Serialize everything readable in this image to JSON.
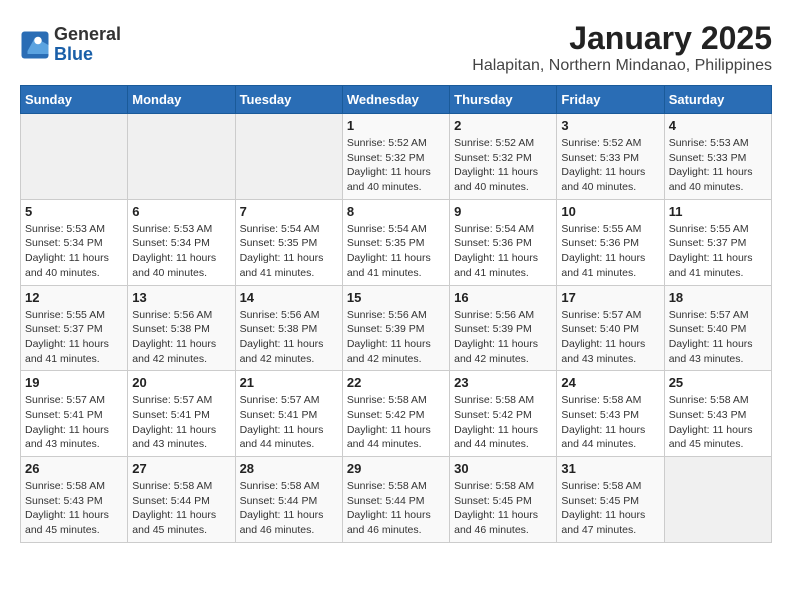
{
  "header": {
    "logo_line1": "General",
    "logo_line2": "Blue",
    "title": "January 2025",
    "subtitle": "Halapitan, Northern Mindanao, Philippines"
  },
  "days_of_week": [
    "Sunday",
    "Monday",
    "Tuesday",
    "Wednesday",
    "Thursday",
    "Friday",
    "Saturday"
  ],
  "weeks": [
    [
      {
        "day": "",
        "info": ""
      },
      {
        "day": "",
        "info": ""
      },
      {
        "day": "",
        "info": ""
      },
      {
        "day": "1",
        "info": "Sunrise: 5:52 AM\nSunset: 5:32 PM\nDaylight: 11 hours\nand 40 minutes."
      },
      {
        "day": "2",
        "info": "Sunrise: 5:52 AM\nSunset: 5:32 PM\nDaylight: 11 hours\nand 40 minutes."
      },
      {
        "day": "3",
        "info": "Sunrise: 5:52 AM\nSunset: 5:33 PM\nDaylight: 11 hours\nand 40 minutes."
      },
      {
        "day": "4",
        "info": "Sunrise: 5:53 AM\nSunset: 5:33 PM\nDaylight: 11 hours\nand 40 minutes."
      }
    ],
    [
      {
        "day": "5",
        "info": "Sunrise: 5:53 AM\nSunset: 5:34 PM\nDaylight: 11 hours\nand 40 minutes."
      },
      {
        "day": "6",
        "info": "Sunrise: 5:53 AM\nSunset: 5:34 PM\nDaylight: 11 hours\nand 40 minutes."
      },
      {
        "day": "7",
        "info": "Sunrise: 5:54 AM\nSunset: 5:35 PM\nDaylight: 11 hours\nand 41 minutes."
      },
      {
        "day": "8",
        "info": "Sunrise: 5:54 AM\nSunset: 5:35 PM\nDaylight: 11 hours\nand 41 minutes."
      },
      {
        "day": "9",
        "info": "Sunrise: 5:54 AM\nSunset: 5:36 PM\nDaylight: 11 hours\nand 41 minutes."
      },
      {
        "day": "10",
        "info": "Sunrise: 5:55 AM\nSunset: 5:36 PM\nDaylight: 11 hours\nand 41 minutes."
      },
      {
        "day": "11",
        "info": "Sunrise: 5:55 AM\nSunset: 5:37 PM\nDaylight: 11 hours\nand 41 minutes."
      }
    ],
    [
      {
        "day": "12",
        "info": "Sunrise: 5:55 AM\nSunset: 5:37 PM\nDaylight: 11 hours\nand 41 minutes."
      },
      {
        "day": "13",
        "info": "Sunrise: 5:56 AM\nSunset: 5:38 PM\nDaylight: 11 hours\nand 42 minutes."
      },
      {
        "day": "14",
        "info": "Sunrise: 5:56 AM\nSunset: 5:38 PM\nDaylight: 11 hours\nand 42 minutes."
      },
      {
        "day": "15",
        "info": "Sunrise: 5:56 AM\nSunset: 5:39 PM\nDaylight: 11 hours\nand 42 minutes."
      },
      {
        "day": "16",
        "info": "Sunrise: 5:56 AM\nSunset: 5:39 PM\nDaylight: 11 hours\nand 42 minutes."
      },
      {
        "day": "17",
        "info": "Sunrise: 5:57 AM\nSunset: 5:40 PM\nDaylight: 11 hours\nand 43 minutes."
      },
      {
        "day": "18",
        "info": "Sunrise: 5:57 AM\nSunset: 5:40 PM\nDaylight: 11 hours\nand 43 minutes."
      }
    ],
    [
      {
        "day": "19",
        "info": "Sunrise: 5:57 AM\nSunset: 5:41 PM\nDaylight: 11 hours\nand 43 minutes."
      },
      {
        "day": "20",
        "info": "Sunrise: 5:57 AM\nSunset: 5:41 PM\nDaylight: 11 hours\nand 43 minutes."
      },
      {
        "day": "21",
        "info": "Sunrise: 5:57 AM\nSunset: 5:41 PM\nDaylight: 11 hours\nand 44 minutes."
      },
      {
        "day": "22",
        "info": "Sunrise: 5:58 AM\nSunset: 5:42 PM\nDaylight: 11 hours\nand 44 minutes."
      },
      {
        "day": "23",
        "info": "Sunrise: 5:58 AM\nSunset: 5:42 PM\nDaylight: 11 hours\nand 44 minutes."
      },
      {
        "day": "24",
        "info": "Sunrise: 5:58 AM\nSunset: 5:43 PM\nDaylight: 11 hours\nand 44 minutes."
      },
      {
        "day": "25",
        "info": "Sunrise: 5:58 AM\nSunset: 5:43 PM\nDaylight: 11 hours\nand 45 minutes."
      }
    ],
    [
      {
        "day": "26",
        "info": "Sunrise: 5:58 AM\nSunset: 5:43 PM\nDaylight: 11 hours\nand 45 minutes."
      },
      {
        "day": "27",
        "info": "Sunrise: 5:58 AM\nSunset: 5:44 PM\nDaylight: 11 hours\nand 45 minutes."
      },
      {
        "day": "28",
        "info": "Sunrise: 5:58 AM\nSunset: 5:44 PM\nDaylight: 11 hours\nand 46 minutes."
      },
      {
        "day": "29",
        "info": "Sunrise: 5:58 AM\nSunset: 5:44 PM\nDaylight: 11 hours\nand 46 minutes."
      },
      {
        "day": "30",
        "info": "Sunrise: 5:58 AM\nSunset: 5:45 PM\nDaylight: 11 hours\nand 46 minutes."
      },
      {
        "day": "31",
        "info": "Sunrise: 5:58 AM\nSunset: 5:45 PM\nDaylight: 11 hours\nand 47 minutes."
      },
      {
        "day": "",
        "info": ""
      }
    ]
  ]
}
